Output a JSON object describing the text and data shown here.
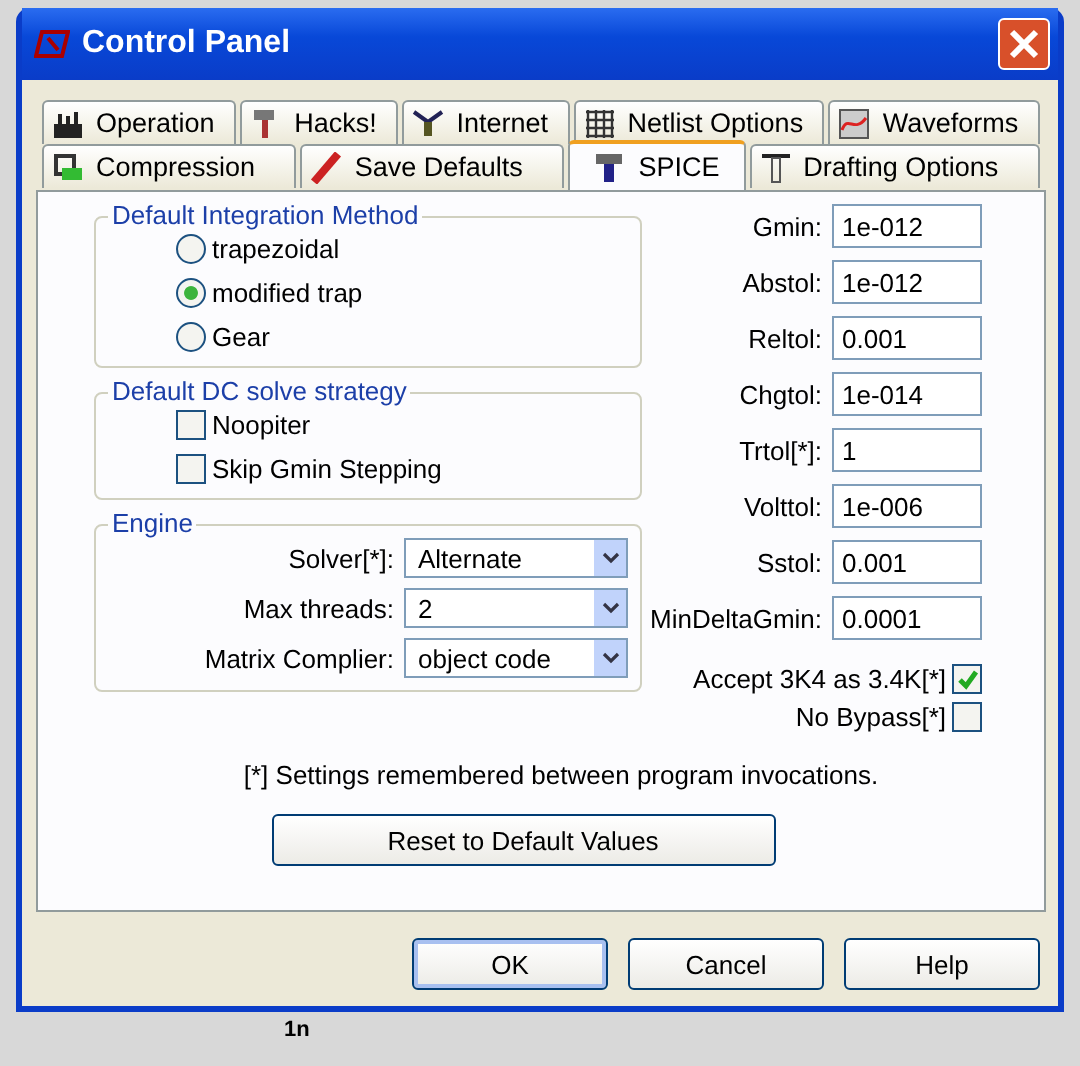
{
  "window": {
    "title": "Control Panel"
  },
  "tab_rows": [
    {
      "tabs": [
        {
          "label": "Operation",
          "selected": false
        },
        {
          "label": "Hacks!",
          "selected": false
        },
        {
          "label": "Internet",
          "selected": false
        },
        {
          "label": "Netlist Options",
          "selected": false
        },
        {
          "label": "Waveforms",
          "selected": false
        }
      ]
    },
    {
      "tabs": [
        {
          "label": "Compression",
          "selected": false
        },
        {
          "label": "Save Defaults",
          "selected": false
        },
        {
          "label": "SPICE",
          "selected": true
        },
        {
          "label": "Drafting Options",
          "selected": false
        }
      ]
    }
  ],
  "integration_method": {
    "title": "Default Integration Method",
    "options": [
      {
        "label": "trapezoidal",
        "selected": false
      },
      {
        "label": "modified trap",
        "selected": true
      },
      {
        "label": "Gear",
        "selected": false
      }
    ]
  },
  "dc_solve_strategy": {
    "title": "Default DC solve strategy",
    "options": [
      {
        "label": "Noopiter",
        "checked": false
      },
      {
        "label": "Skip Gmin Stepping",
        "checked": false
      }
    ]
  },
  "engine": {
    "title": "Engine",
    "dropdowns": [
      {
        "label": "Solver[*]:",
        "value": "Alternate"
      },
      {
        "label": "Max threads:",
        "value": "2"
      },
      {
        "label": "Matrix Complier:",
        "value": "object code"
      }
    ]
  },
  "tolerances": [
    {
      "label": "Gmin:",
      "value": "1e-012"
    },
    {
      "label": "Abstol:",
      "value": "1e-012"
    },
    {
      "label": "Reltol:",
      "value": "0.001"
    },
    {
      "label": "Chgtol:",
      "value": "1e-014"
    },
    {
      "label": "Trtol[*]:",
      "value": "1"
    },
    {
      "label": "Volttol:",
      "value": "1e-006"
    },
    {
      "label": "Sstol:",
      "value": "0.001"
    },
    {
      "label": "MinDeltaGmin:",
      "value": "0.0001"
    }
  ],
  "options": [
    {
      "label": "Accept 3K4 as 3.4K[*]",
      "checked": true
    },
    {
      "label": "No Bypass[*]",
      "checked": false
    }
  ],
  "footnote": "[*] Settings remembered between program invocations.",
  "reset_button": "Reset to Default Values",
  "buttons": [
    "OK",
    "Cancel",
    "Help"
  ],
  "background_text": "1n"
}
